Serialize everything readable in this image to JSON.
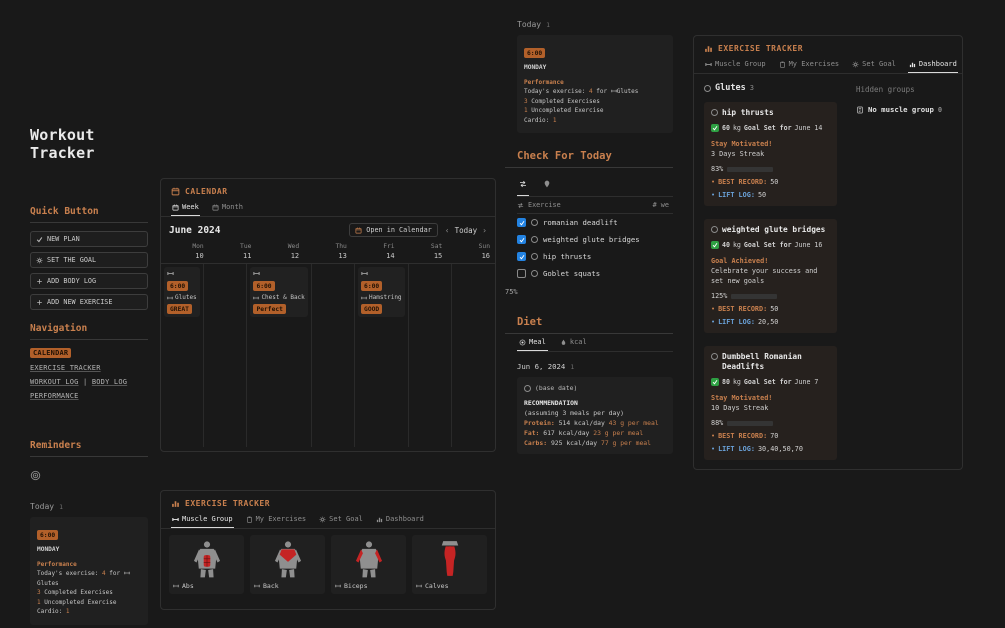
{
  "colors": {
    "accent": "#c9804e",
    "badge_bg": "#b2602a",
    "green": "#57a85a",
    "blue": "#6aa1d8",
    "checkbox_blue": "#2383e2",
    "red_muscle": "#c52424"
  },
  "sidebar": {
    "title": "Workout Tracker",
    "quick_heading": "Quick Button",
    "buttons": [
      {
        "label": "NEW PLAN"
      },
      {
        "label": "SET THE GOAL"
      },
      {
        "label": "ADD BODY LOG"
      },
      {
        "label": "ADD NEW EXERCISE"
      }
    ],
    "nav_heading": "Navigation",
    "nav_items": [
      "CALENDAR",
      "EXERCISE TRACKER",
      "WORKOUT LOG",
      "BODY LOG",
      "PERFORMANCE"
    ],
    "nav_separator": "|",
    "reminders_heading": "Reminders"
  },
  "today_feed": {
    "label": "Today",
    "count": "1"
  },
  "reminder_card": {
    "time": "6:00",
    "day": "MONDAY",
    "performance": "Performance",
    "exercise_line": {
      "prefix": "Today's exercise: ",
      "count": "4",
      "mid": " for ",
      "muscle": "Glutes"
    },
    "completed": {
      "count": "3",
      "text": " Completed Exercises"
    },
    "uncompleted": {
      "count": "1",
      "text": " Uncompleted Exercise"
    },
    "cardio": {
      "label": "Cardio: ",
      "count": "1"
    }
  },
  "calendar": {
    "heading": "CALENDAR",
    "tab_week": "Week",
    "tab_month": "Month",
    "month_label": "June 2024",
    "open_button": "Open in Calendar",
    "today_button": "Today",
    "prev": "‹",
    "next": "›",
    "days": [
      "Mon",
      "Tue",
      "Wed",
      "Thu",
      "Fri",
      "Sat",
      "Sun"
    ],
    "dates": [
      "10",
      "11",
      "12",
      "13",
      "14",
      "15",
      "16"
    ],
    "events": [
      {
        "time": "6:00",
        "muscle": "Glutes",
        "rating": "GREAT"
      },
      {
        "time": "6:00",
        "muscle": "Chest & Back",
        "rating": "Perfect"
      },
      {
        "time": "6:00",
        "muscle": "Hamstring",
        "rating": "GOOD"
      }
    ]
  },
  "muscle_tracker": {
    "heading": "EXERCISE TRACKER",
    "tabs": [
      "Muscle Group",
      "My Exercises",
      "Set Goal",
      "Dashboard"
    ],
    "cards": [
      {
        "label": "Abs"
      },
      {
        "label": "Back"
      },
      {
        "label": "Biceps"
      },
      {
        "label": "Calves"
      }
    ]
  },
  "check_today": {
    "heading": "Check For Today",
    "header_exercise": "Exercise",
    "header_col2": "# we",
    "rows": [
      {
        "label": "romanian deadlift",
        "checked": true
      },
      {
        "label": "weighted glute bridges",
        "checked": true
      },
      {
        "label": "hip thrusts",
        "checked": true
      },
      {
        "label": "Goblet squats",
        "checked": false
      }
    ],
    "progress": "75%"
  },
  "diet": {
    "heading": "Diet",
    "tab_meal": "Meal",
    "tab_kcal": "kcal",
    "date_label": "Jun 6, 2024",
    "date_count": "1",
    "card_title": "(base date)",
    "rec_heading": "RECOMMENDATION",
    "rec_sub": "(assuming 3 meals per day)",
    "macros": [
      {
        "name": "Protein:",
        "kcal": " 514 kcal/day ",
        "per_meal": "43 g per meal"
      },
      {
        "name": "Fat:",
        "kcal": " 617 kcal/day  ",
        "per_meal": "23 g per meal"
      },
      {
        "name": "Carbs:",
        "kcal": " 925 kcal/day ",
        "per_meal": "77 g per meal"
      }
    ]
  },
  "dashboard": {
    "heading": "EXERCISE TRACKER",
    "tabs": [
      "Muscle Group",
      "My Exercises",
      "Set Goal",
      "Dashboard"
    ],
    "group_name": "Glutes",
    "group_count": "3",
    "kg_label": "kg",
    "goal_mid": "Goal Set for",
    "best_label": "BEST RECORD:",
    "lift_label": "LIFT LOG:",
    "bullet": "•",
    "cards": [
      {
        "title": "hip thrusts",
        "kg": "60",
        "date": "June 14",
        "status": "Stay Motivated!",
        "status_sub": "3 Days Streak",
        "percent": "83%",
        "best": "50",
        "lift": "50"
      },
      {
        "title": "weighted glute bridges",
        "kg": "40",
        "date": "June 16",
        "status": "Goal Achieved!",
        "status_sub": "Celebrate your success and set new goals",
        "percent": "125%",
        "best": "50",
        "lift": "20,50"
      },
      {
        "title": "Dumbbell Romanian Deadlifts",
        "kg": "80",
        "date": "June 7",
        "status": "Stay Motivated!",
        "status_sub": "10 Days Streak",
        "percent": "88%",
        "best": "70",
        "lift": "30,40,50,70"
      }
    ],
    "hidden_heading": "Hidden groups",
    "hidden_item": "No muscle group",
    "hidden_count": "0"
  }
}
